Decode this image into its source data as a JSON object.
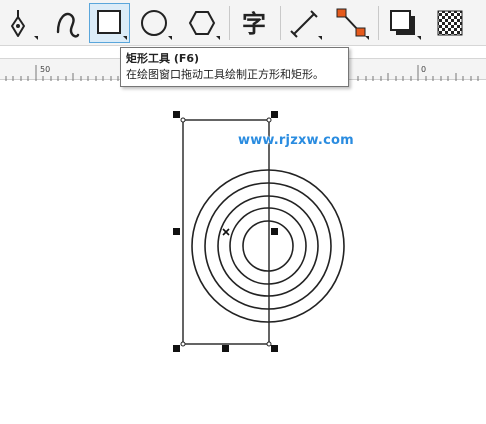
{
  "toolbar": {
    "tools": [
      {
        "name": "pen-tool",
        "icon": "pen-nib-icon",
        "has_flyout": true
      },
      {
        "name": "bspline-tool",
        "icon": "curve-icon",
        "has_flyout": false
      },
      {
        "name": "rectangle-tool",
        "icon": "rectangle-icon",
        "has_flyout": true,
        "active": true
      },
      {
        "name": "ellipse-tool",
        "icon": "ellipse-icon",
        "has_flyout": true
      },
      {
        "name": "polygon-tool",
        "icon": "hexagon-icon",
        "has_flyout": true
      },
      {
        "name": "text-tool",
        "icon": "text-char-icon",
        "glyph": "字"
      },
      {
        "name": "dimension-tool",
        "icon": "dimension-line-icon",
        "has_flyout": true
      },
      {
        "name": "connector-tool",
        "icon": "connector-icon",
        "has_flyout": true
      },
      {
        "name": "drop-shadow-tool",
        "icon": "drop-shadow-icon",
        "has_flyout": true
      },
      {
        "name": "transparency-tool",
        "icon": "checkerboard-icon",
        "has_flyout": false
      }
    ]
  },
  "tooltip": {
    "title": "矩形工具 (F6)",
    "description": "在绘图窗口拖动工具绘制正方形和矩形。"
  },
  "ruler": {
    "labels": [
      "50",
      "0"
    ]
  },
  "canvas": {
    "watermark": "www.rjzxw.com"
  },
  "colors": {
    "active_tool_bg": "#dcecf8",
    "active_tool_border": "#5aa6db",
    "watermark": "#2a8ce0",
    "connector_accent": "#e55a1c"
  }
}
